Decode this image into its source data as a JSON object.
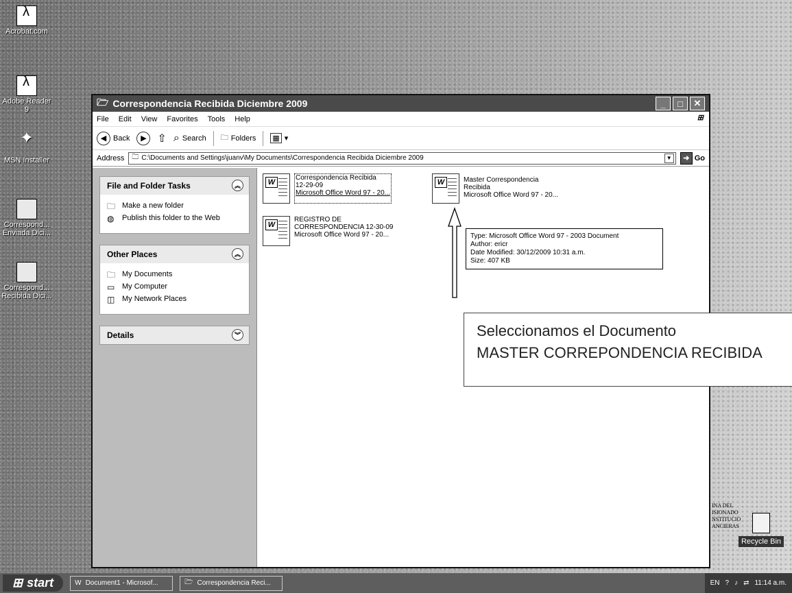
{
  "desktop": {
    "icons": [
      {
        "label": "Acrobat.com",
        "icon": "acrobat-icon"
      },
      {
        "label": "Adobe Reader 9",
        "icon": "pdf-icon"
      },
      {
        "label": "MSN Installer",
        "icon": "msn-icon"
      },
      {
        "label": "Correspond... Enviada Dici...",
        "icon": "folder-shortcut-icon"
      },
      {
        "label": "Correspond... Recibida Dici...",
        "icon": "folder-shortcut-icon"
      }
    ],
    "recycle_bin": "Recycle Bin",
    "stamp_lines": [
      "INA DEL",
      "ISIONADO",
      "NSTITUCIO",
      "ANCIERAS"
    ]
  },
  "window": {
    "title": "Correspondencia Recibida Diciembre 2009",
    "menu": [
      "File",
      "Edit",
      "View",
      "Favorites",
      "Tools",
      "Help"
    ],
    "toolbar": {
      "back": "Back",
      "search": "Search",
      "folders": "Folders"
    },
    "address": {
      "label": "Address",
      "value": "C:\\Documents and Settings\\juanv\\My Documents\\Correspondencia Recibida Diciembre 2009",
      "go": "Go"
    },
    "tasks": {
      "file_folder_tasks": {
        "title": "File and Folder Tasks",
        "items": [
          "Make a new folder",
          "Publish this folder to the Web"
        ]
      },
      "other_places": {
        "title": "Other Places",
        "items": [
          "My Documents",
          "My Computer",
          "My Network Places"
        ]
      },
      "details": {
        "title": "Details"
      }
    },
    "files": [
      {
        "name_line1": "Correspondencia Recibida",
        "name_line2": "12-29-09",
        "type": "Microsoft Office Word 97 - 20..."
      },
      {
        "name_line1": "Master Correspondencia",
        "name_line2": "Recibida",
        "type": "Microsoft Office Word 97 - 20..."
      },
      {
        "name_line1": "REGISTRO DE",
        "name_line2": "CORRESPONDENCIA 12-30-09",
        "type": "Microsoft Office Word 97 - 20..."
      }
    ],
    "tooltip": {
      "type": "Type: Microsoft Office Word 97 - 2003 Document",
      "author": "Author: ericr",
      "date": "Date Modified: 30/12/2009 10:31 a.m.",
      "size": "Size: 407 KB"
    }
  },
  "annotation": {
    "line1": "Seleccionamos el Documento",
    "line2": "MASTER CORREPONDENCIA RECIBIDA"
  },
  "taskbar": {
    "start": "start",
    "tasks": [
      "Document1 - Microsof...",
      "Correspondencia Reci..."
    ],
    "tray_lang": "EN",
    "clock": "11:14 a.m."
  }
}
